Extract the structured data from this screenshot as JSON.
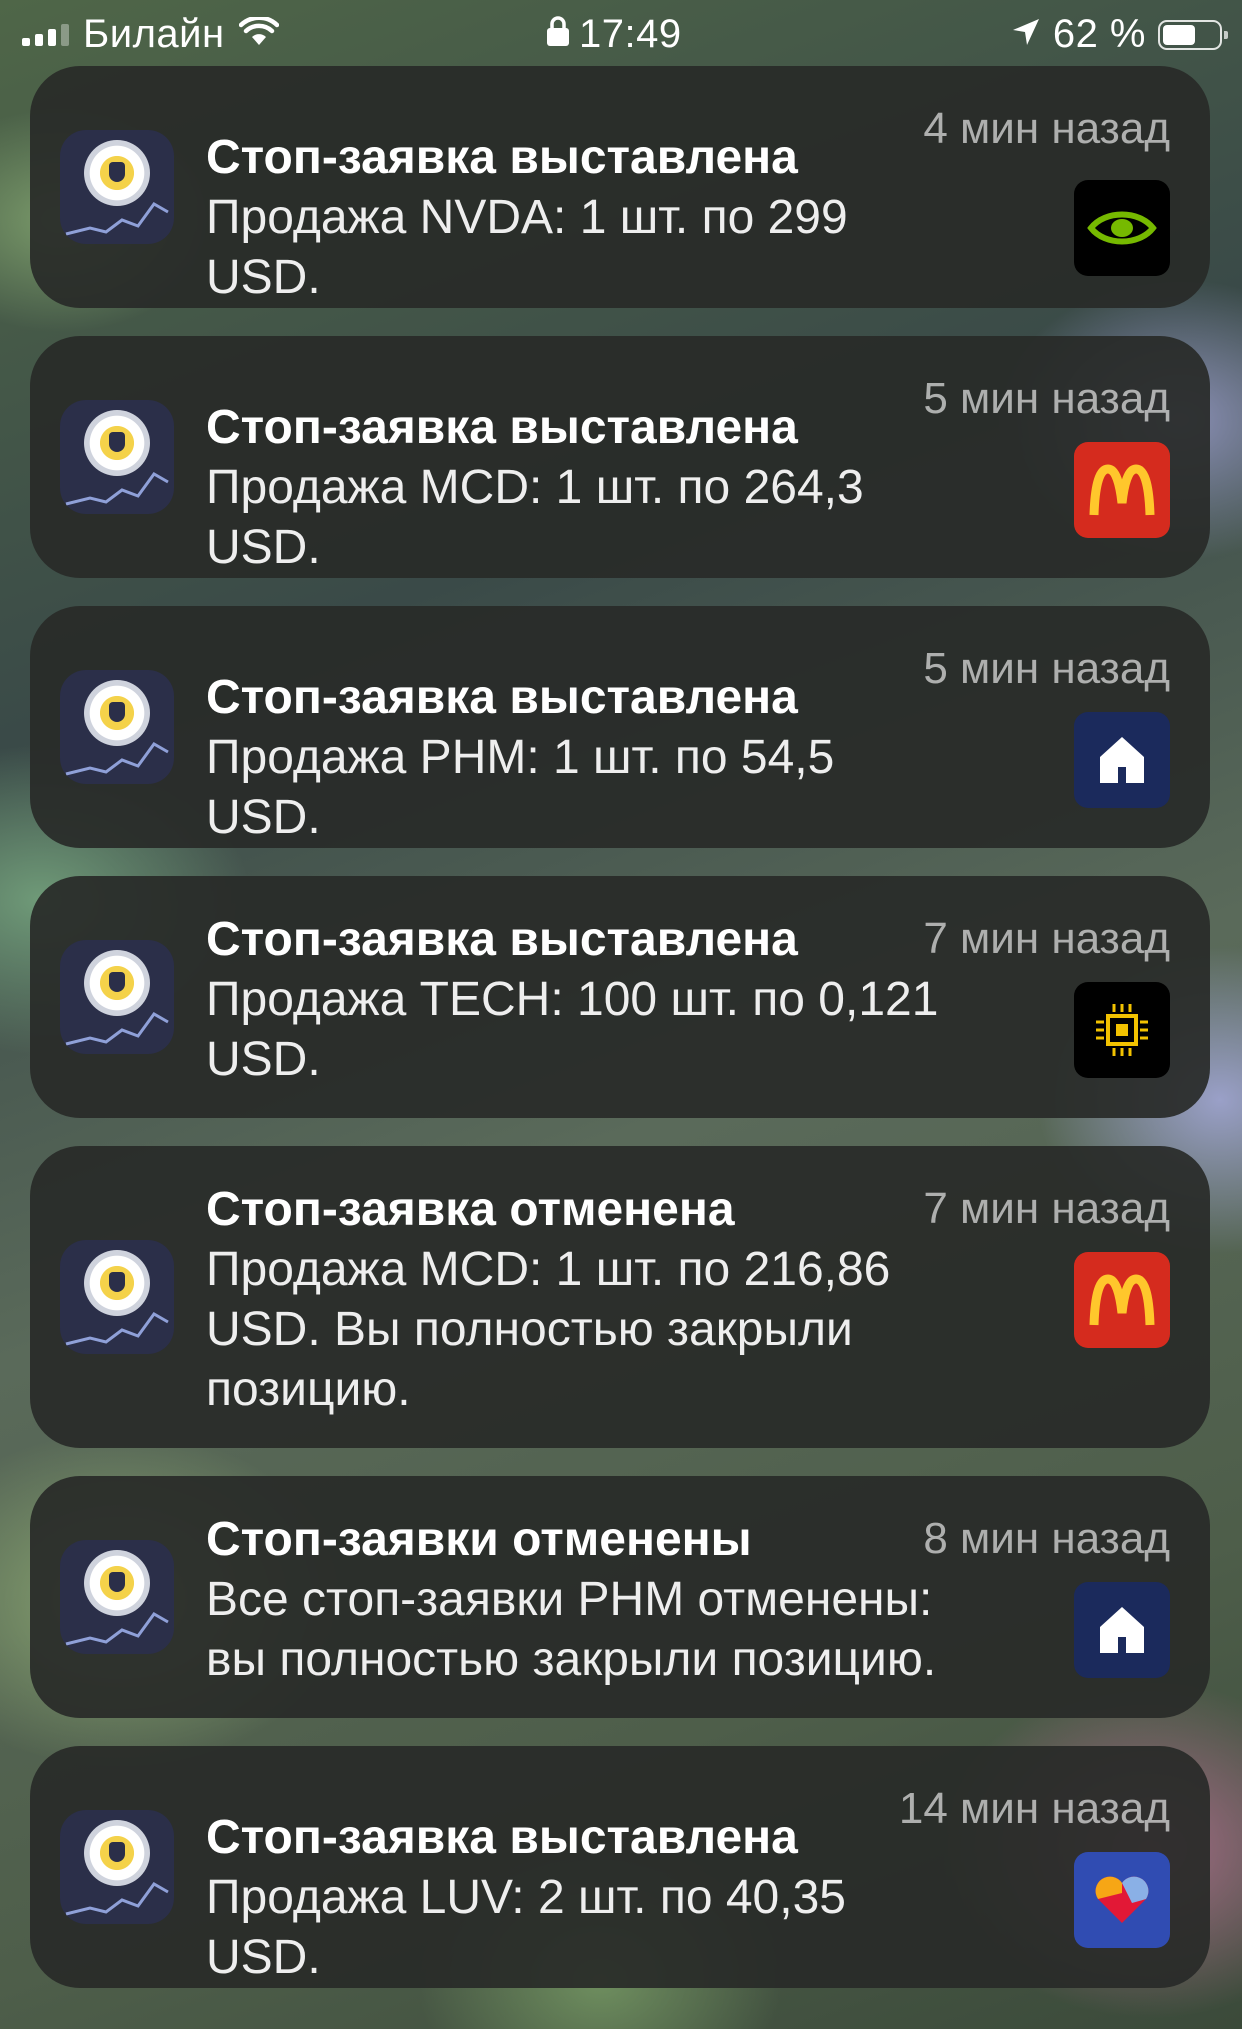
{
  "status_bar": {
    "carrier": "Билайн",
    "time": "17:49",
    "battery_percent_text": "62 %",
    "battery_level": 0.62,
    "icons": [
      "signal-icon",
      "wifi-icon",
      "lock-icon",
      "location-arrow-icon",
      "battery-icon"
    ]
  },
  "notifications": [
    {
      "app": "Tinkoff Investments",
      "title": "Стоп-заявка выставлена",
      "body": "Продажа NVDA: 1 шт. по 299 USD.",
      "time": "4 мин назад",
      "ticker_logo": "nvidia-logo",
      "accent": "#76b900"
    },
    {
      "app": "Tinkoff Investments",
      "title": "Стоп-заявка выставлена",
      "body": "Продажа MCD: 1 шт. по 264,3 USD.",
      "time": "5 мин назад",
      "ticker_logo": "mcdonalds-logo",
      "accent": "#ffc72c"
    },
    {
      "app": "Tinkoff Investments",
      "title": "Стоп-заявка выставлена",
      "body": "Продажа PHM: 1 шт. по 54,5 USD.",
      "time": "5 мин назад",
      "ticker_logo": "pultegroup-house-logo",
      "accent": "#1b2a5c"
    },
    {
      "app": "Tinkoff Investments",
      "title": "Стоп-заявка выставлена",
      "body": "Продажа TECH: 100 шт. по 0,121 USD.",
      "time": "7 мин назад",
      "ticker_logo": "chip-logo",
      "accent": "#f2c200"
    },
    {
      "app": "Tinkoff Investments",
      "title": "Стоп-заявка отменена",
      "body": "Продажа MCD: 1 шт. по 216,86 USD. Вы полностью закрыли позицию.",
      "time": "7 мин назад",
      "ticker_logo": "mcdonalds-logo",
      "accent": "#ffc72c"
    },
    {
      "app": "Tinkoff Investments",
      "title": "Стоп-заявки отменены",
      "body": "Все стоп-заявки PHM отменены: вы полностью закрыли позицию.",
      "time": "8 мин назад",
      "ticker_logo": "pultegroup-house-logo",
      "accent": "#1b2a5c"
    },
    {
      "app": "Tinkoff Investments",
      "title": "Стоп-заявка выставлена",
      "body": "Продажа LUV: 2 шт. по 40,35 USD.",
      "time": "14 мин назад",
      "ticker_logo": "southwest-heart-logo",
      "accent": "#304cb2"
    }
  ]
}
